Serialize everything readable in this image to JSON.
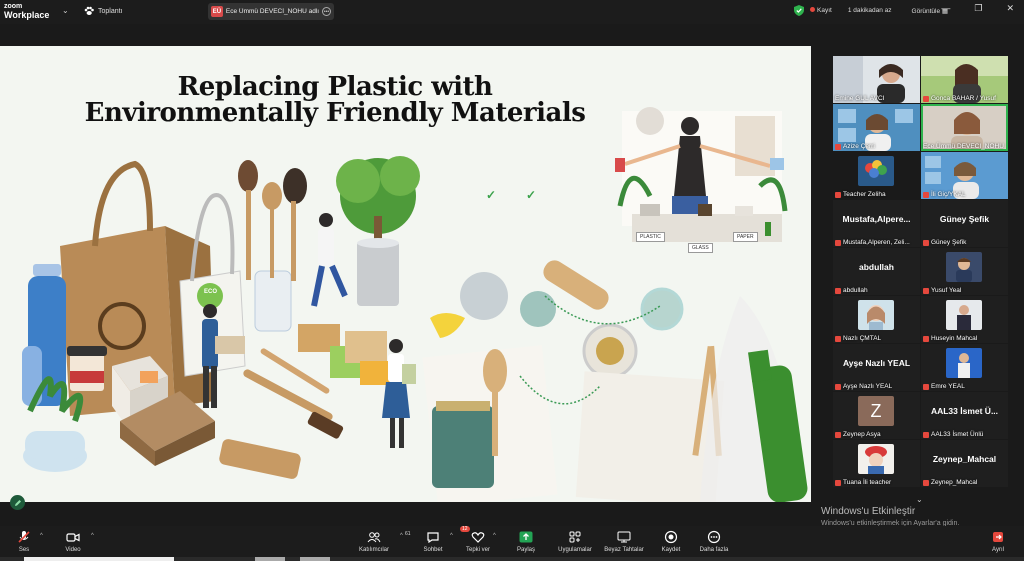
{
  "titlebar": {
    "logo_line1": "zoom",
    "logo_line2": "Workplace",
    "meeting_label": "Toplantı",
    "share_badge": "EÜ",
    "share_text": "Ece Ümmü DEVECİ_NOHU adlı ki",
    "recording_label": "Kayıt",
    "duration_label": "1 dakikadan az",
    "view_label": "Görüntüle",
    "minimize": "—",
    "restore": "❐",
    "close": "✕"
  },
  "slide": {
    "title_line1": "Replacing Plastic with",
    "title_line2": "Environmentally Friendly Materials",
    "label_plastic": "PLASTIC",
    "label_glass": "GLASS",
    "label_paper": "PAPER",
    "label_eco": "ECO"
  },
  "gallery": {
    "participants": [
      {
        "name": "Emine GUL AVCI",
        "display": ""
      },
      {
        "name": "Gonca BAHAR / Yusuf",
        "display": ""
      },
      {
        "name": "Azize Çerri",
        "display": ""
      },
      {
        "name": "Ece Ümmü DEVECI_NOHU",
        "display": ""
      },
      {
        "name": "Teacher Zeliha",
        "display": ""
      },
      {
        "name": "İli Giç/YKAL",
        "display": ""
      },
      {
        "name": "Mustafa,Alperen, Zeli...",
        "display": "Mustafa,Alpere..."
      },
      {
        "name": "Güney Şefik",
        "display": "Güney Şefik"
      },
      {
        "name": "abdullah",
        "display": "abdullah"
      },
      {
        "name": "Yusuf Yeal",
        "display": ""
      },
      {
        "name": "Nazlı ÇMTAL",
        "display": ""
      },
      {
        "name": "Huseyin Mahcal",
        "display": ""
      },
      {
        "name": "Ayşe Nazlı YEAL",
        "display": "Ayşe Nazlı YEAL"
      },
      {
        "name": "Emre YEAL",
        "display": ""
      },
      {
        "name": "Zeynep Asya",
        "display": ""
      },
      {
        "name": "AAL33 İsmet Ünlü",
        "display": "AAL33 İsmet Ü..."
      },
      {
        "name": "Tuana İli teacher",
        "display": ""
      },
      {
        "name": "Zeynep_Mahcal",
        "display": "Zeynep_Mahcal"
      }
    ],
    "avatar_letter": "Z"
  },
  "watermark": {
    "line1": "Windows'u Etkinleştir",
    "line2": "Windows'u etkinleştirmek için Ayarlar'a gidin."
  },
  "toolbar": {
    "mute": "Ses",
    "video": "Video",
    "participants": "Katılımcılar",
    "participants_count": "61",
    "chat": "Sohbet",
    "chat_badge": "12",
    "reactions": "Tepki ver",
    "share": "Paylaş",
    "apps": "Uygulamalar",
    "whiteboard": "Beyaz Tahtalar",
    "record": "Kaydet",
    "more": "Daha fazla",
    "leave": "Ayrıl"
  },
  "colors": {
    "accent_green": "#2fb34e",
    "record_red": "#e5483d",
    "bg": "#1a1a1a"
  }
}
